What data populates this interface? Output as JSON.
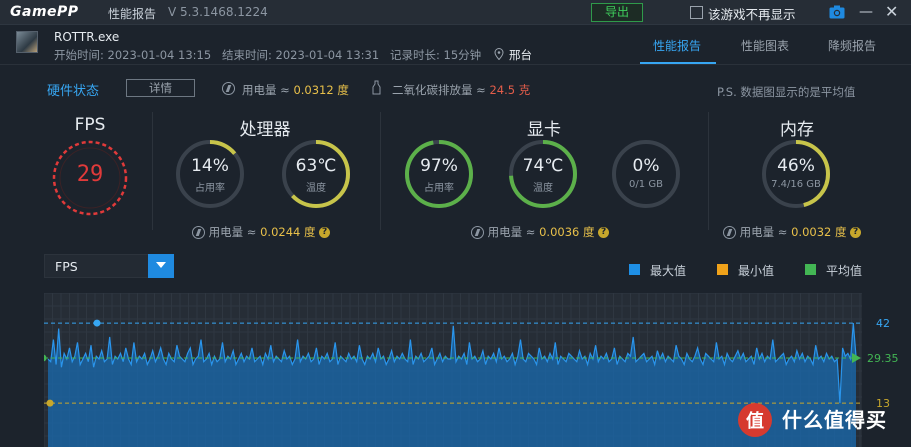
{
  "window": {
    "logo": "GamePP",
    "title": "性能报告",
    "version": "V 5.3.1468.1224",
    "export_label": "导出",
    "no_show_label": "该游戏不再显示"
  },
  "session": {
    "game_name": "ROTTR.exe",
    "start_time": "开始时间: 2023-01-04 13:15",
    "end_time": "结束时间: 2023-01-04 13:31",
    "duration": "记录时长: 15分钟",
    "location": "邢台"
  },
  "tabs": [
    {
      "label": "性能报告",
      "active": true
    },
    {
      "label": "性能图表",
      "active": false
    },
    {
      "label": "降频报告",
      "active": false
    }
  ],
  "hw": {
    "status_label": "硬件状态",
    "detail_label": "详情",
    "power_prefix": "用电量 ≈ ",
    "power_value": "0.0312 度",
    "co2_prefix": "二氧化碳排放量 ≈ ",
    "co2_value": "24.5 克",
    "note": "P.S. 数据图显示的是平均值"
  },
  "fps": {
    "title": "FPS",
    "value": "29"
  },
  "cpu": {
    "title": "处理器",
    "usage": {
      "value": "14%",
      "label": "占用率",
      "fraction": 0.14
    },
    "temp": {
      "value": "63℃",
      "label": "温度",
      "fraction": 0.63
    },
    "power_prefix": "用电量 ≈ ",
    "power_value": "0.0244 度"
  },
  "gpu": {
    "title": "显卡",
    "usage": {
      "value": "97%",
      "label": "占用率",
      "fraction": 0.97
    },
    "temp": {
      "value": "74℃",
      "label": "温度",
      "fraction": 0.74
    },
    "vram": {
      "value": "0%",
      "label": "0/1 GB",
      "fraction": 0.0
    },
    "power_prefix": "用电量 ≈ ",
    "power_value": "0.0036 度"
  },
  "mem": {
    "title": "内存",
    "usage": {
      "value": "46%",
      "label": "7.4/16 GB",
      "fraction": 0.46
    },
    "power_prefix": "用电量 ≈ ",
    "power_value": "0.0032 度"
  },
  "chart_selector": {
    "value": "FPS"
  },
  "legend": [
    {
      "label": "最大值",
      "color": "#1e8fe6"
    },
    {
      "label": "最小值",
      "color": "#f0a21a"
    },
    {
      "label": "平均值",
      "color": "#43b654"
    }
  ],
  "colors": {
    "accent": "#37a6f2",
    "gauge_low": "#c7c44a",
    "gauge_high": "#5cb04a",
    "fps_ring": "#e03a3a",
    "line": "#1e8fe6"
  },
  "chart_data": {
    "type": "area",
    "series_max": 42,
    "series_min": 13,
    "series_avg": 29.35,
    "right_labels": [
      "42",
      "29.35",
      "13"
    ],
    "ylim": [
      0,
      50
    ],
    "values": [
      29,
      28,
      36,
      27,
      40,
      26,
      31,
      29,
      33,
      28,
      30,
      35,
      27,
      29,
      31,
      28,
      34,
      26,
      30,
      29,
      32,
      28,
      29,
      37,
      27,
      30,
      29,
      31,
      28,
      33,
      29,
      27,
      35,
      28,
      30,
      29,
      31,
      27,
      29,
      32,
      28,
      30,
      33,
      29,
      27,
      31,
      29,
      28,
      34,
      30,
      29,
      28,
      31,
      33,
      27,
      29,
      30,
      36,
      28,
      29,
      31,
      27,
      30,
      28,
      29,
      35,
      28,
      30,
      29,
      32,
      27,
      29,
      31,
      28,
      30,
      29,
      33,
      28,
      29,
      30,
      27,
      31,
      29,
      34,
      28,
      30,
      29,
      28,
      32,
      29,
      30,
      27,
      29,
      36,
      28,
      30,
      29,
      31,
      28,
      29,
      33,
      27,
      30,
      29,
      31,
      28,
      29,
      35,
      27,
      30,
      29,
      28,
      31,
      29,
      30,
      28,
      34,
      29,
      27,
      30,
      29,
      31,
      28,
      33,
      29,
      30,
      27,
      29,
      32,
      28,
      30,
      29,
      31,
      29,
      28,
      36,
      27,
      30,
      29,
      31,
      28,
      29,
      30,
      33,
      27,
      29,
      31,
      28,
      30,
      29,
      29,
      41,
      28,
      30,
      29,
      31,
      27,
      35,
      29,
      30,
      28,
      29,
      32,
      27,
      30,
      29,
      31,
      28,
      33,
      29,
      30,
      28,
      29,
      31,
      27,
      30,
      36,
      29,
      28,
      31,
      30,
      29,
      27,
      33,
      29,
      30,
      28,
      31,
      29,
      35,
      27,
      30,
      29,
      28,
      31,
      30,
      29,
      28,
      32,
      29,
      30,
      27,
      31,
      29,
      34,
      28,
      30,
      29,
      31,
      28,
      29,
      33,
      27,
      30,
      29,
      28,
      31,
      30,
      37,
      28,
      29,
      30,
      31,
      28,
      29,
      30,
      27,
      32,
      29,
      31,
      28,
      30,
      29,
      28,
      34,
      30,
      29,
      27,
      31,
      29,
      28,
      30,
      33,
      29,
      27,
      31,
      30,
      29,
      28,
      35,
      29,
      30,
      27,
      31,
      29,
      28,
      30,
      32,
      29,
      31,
      28,
      29,
      30,
      27,
      33,
      29,
      31,
      28,
      30,
      29,
      36,
      28,
      29,
      30,
      31,
      27,
      29,
      30,
      28,
      32,
      29,
      31,
      28,
      30,
      29,
      27,
      34,
      29,
      30,
      28,
      31,
      29,
      30,
      28,
      29,
      13,
      33,
      30,
      31,
      29,
      42,
      30
    ]
  },
  "watermark": {
    "text": "什么值得买"
  }
}
